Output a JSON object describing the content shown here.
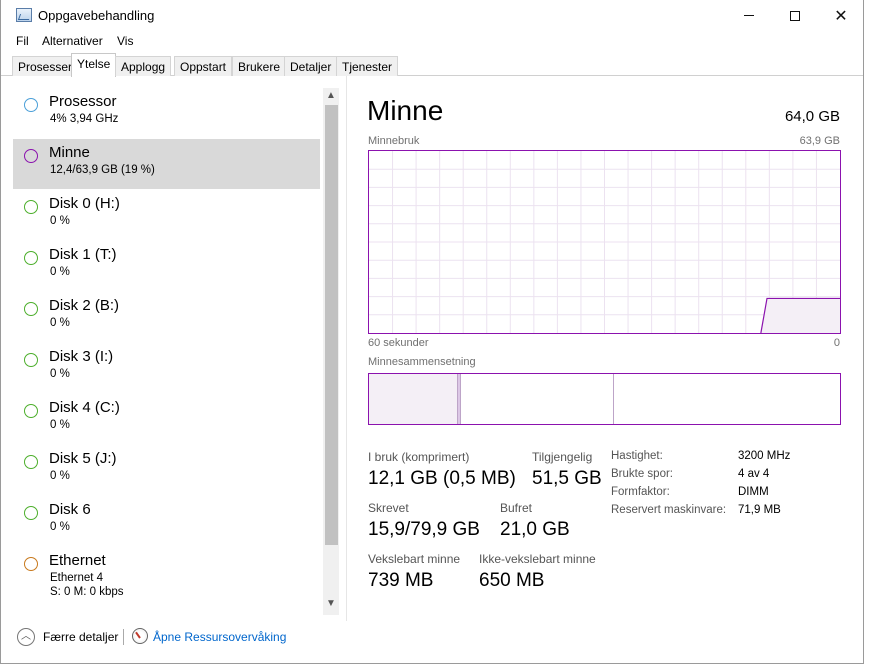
{
  "window": {
    "title": "Oppgavebehandling"
  },
  "icons": {
    "app": "task-manager-icon",
    "minimize": "minimize-icon",
    "maximize": "maximize-icon",
    "close": "close-icon"
  },
  "menu": [
    {
      "label": "Fil"
    },
    {
      "label": "Alternativer"
    },
    {
      "label": "Vis"
    }
  ],
  "tabs": [
    {
      "label": "Prosesser"
    },
    {
      "label": "Ytelse",
      "active": true
    },
    {
      "label": "Applogg"
    },
    {
      "label": "Oppstart"
    },
    {
      "label": "Brukere"
    },
    {
      "label": "Detaljer"
    },
    {
      "label": "Tjenester"
    }
  ],
  "resources": [
    {
      "name": "Prosessor",
      "detail": "4%  3,94 GHz",
      "color": "#4a9fd8"
    },
    {
      "name": "Minne",
      "detail": "12,4/63,9 GB (19 %)",
      "color": "#8b12ae",
      "selected": true
    },
    {
      "name": "Disk 0 (H:)",
      "detail": "0 %",
      "color": "#4daf2c"
    },
    {
      "name": "Disk 1 (T:)",
      "detail": "0 %",
      "color": "#4daf2c"
    },
    {
      "name": "Disk 2 (B:)",
      "detail": "0 %",
      "color": "#4daf2c"
    },
    {
      "name": "Disk 3 (I:)",
      "detail": "0 %",
      "color": "#4daf2c"
    },
    {
      "name": "Disk 4 (C:)",
      "detail": "0 %",
      "color": "#4daf2c"
    },
    {
      "name": "Disk 5 (J:)",
      "detail": "0 %",
      "color": "#4daf2c"
    },
    {
      "name": "Disk 6",
      "detail": "0 %",
      "color": "#4daf2c"
    },
    {
      "name": "Ethernet",
      "detail": "Ethernet 4",
      "detail2": "S: 0 M: 0 kbps",
      "color": "#c8791d"
    }
  ],
  "memory": {
    "title": "Minne",
    "total": "64,0 GB",
    "graph_label": "Minnebruk",
    "graph_max": "63,9 GB",
    "time_left": "60 sekunder",
    "time_right": "0",
    "composition_label": "Minnesammensetning",
    "composition": [
      {
        "fraction": 0.19,
        "fill": "#f4eff6"
      },
      {
        "fraction": 0.005,
        "fill": "#dcc7e6"
      },
      {
        "fraction": 0.325,
        "fill": "#ffffff"
      },
      {
        "fraction": 0.48,
        "fill": "#ffffff"
      }
    ],
    "usage_series": [
      0.19,
      0.19,
      0.19
    ],
    "stats": {
      "in_use_label": "I bruk (komprimert)",
      "in_use_value": "12,1 GB (0,5 MB)",
      "available_label": "Tilgjengelig",
      "available_value": "51,5 GB",
      "committed_label": "Skrevet",
      "committed_value": "15,9/79,9 GB",
      "cached_label": "Bufret",
      "cached_value": "21,0 GB",
      "paged_label": "Vekslebart minne",
      "paged_value": "739 MB",
      "nonpaged_label": "Ikke-vekslebart minne",
      "nonpaged_value": "650 MB"
    },
    "specs": [
      {
        "label": "Hastighet:",
        "value": "3200 MHz"
      },
      {
        "label": "Brukte spor:",
        "value": "4 av 4"
      },
      {
        "label": "Formfaktor:",
        "value": "DIMM"
      },
      {
        "label": "Reservert maskinvare:",
        "value": "71,9 MB"
      }
    ]
  },
  "footer": {
    "fewer_details": "Færre detaljer",
    "resmon": "Åpne Ressursovervåking"
  }
}
